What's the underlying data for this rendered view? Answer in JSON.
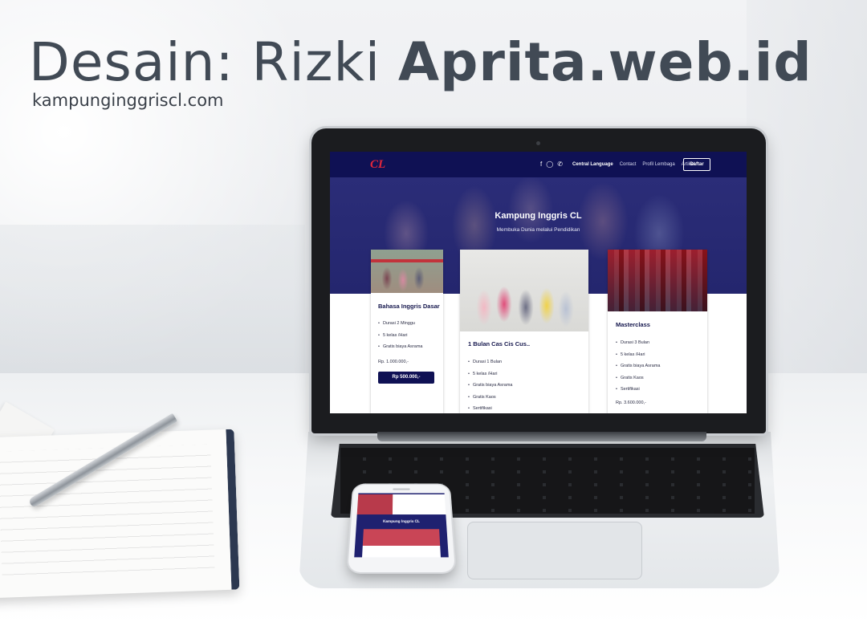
{
  "headline": {
    "light": "Desain: Rizki ",
    "bold": "Aprita.web.id",
    "sub": "kampunginggriscl.com"
  },
  "site": {
    "logo_text": "CL",
    "nav": {
      "icons": [
        "facebook-icon",
        "instagram-icon",
        "phone-icon"
      ],
      "links": [
        "Central Language",
        "Contact",
        "Profil Lembaga",
        "Artikel"
      ],
      "active_link": "Central Language",
      "cta": "Daftar"
    },
    "hero": {
      "title": "Kampung Inggris CL",
      "subtitle": "Membuka Dunia melalui Pendidikan"
    },
    "cards": [
      {
        "title": "Bahasa Inggris Dasar",
        "features": [
          "Durasi 2 Minggu",
          "5 kelas /Hari",
          "Gratis biaya Asrama"
        ],
        "price": "Rp. 1.000.000,-",
        "button": "Rp 500.000,-"
      },
      {
        "title": "1 Bulan Cas Cis Cus..",
        "features": [
          "Durasi 1 Bulan",
          "5 kelas /Hari",
          "Gratis biaya Asrama",
          "Gratis Kaos",
          "Sertifikasi"
        ]
      },
      {
        "title": "Masterclass",
        "features": [
          "Durasi 3 Bulan",
          "5 kelas /Hari",
          "Gratis biaya Asrama",
          "Gratis Kaos",
          "Sertifikasi"
        ],
        "price": "Rp. 3.600.000,-"
      }
    ]
  },
  "phone": {
    "title": "Kampung Inggris CL"
  },
  "colors": {
    "brand_navy": "#0f1154",
    "logo_red": "#e3263b",
    "headline_gray": "#414a55"
  }
}
